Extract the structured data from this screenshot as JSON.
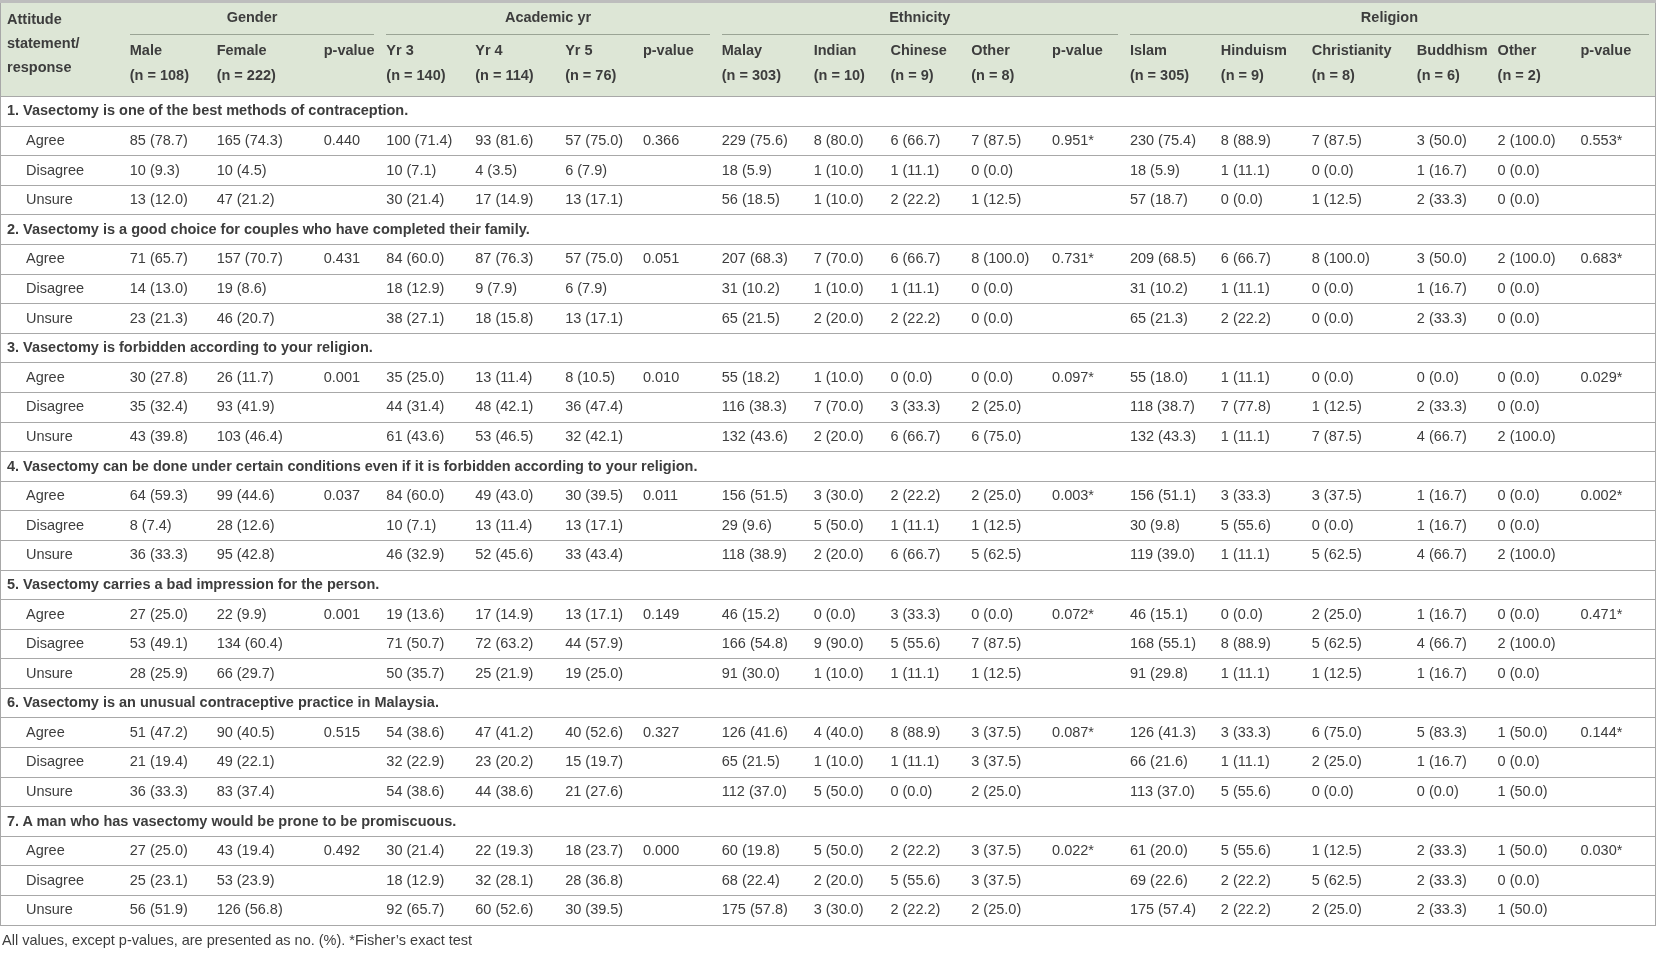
{
  "table": {
    "corner_header": "Attitude statement/ response",
    "groups": [
      {
        "title": "Gender",
        "columns": [
          {
            "label": "Male",
            "n": "(n = 108)"
          },
          {
            "label": "Female",
            "n": "(n = 222)"
          }
        ],
        "p_label": "p-value"
      },
      {
        "title": "Academic yr",
        "columns": [
          {
            "label": "Yr 3",
            "n": "(n = 140)"
          },
          {
            "label": "Yr 4",
            "n": "(n = 114)"
          },
          {
            "label": "Yr 5",
            "n": "(n = 76)"
          }
        ],
        "p_label": "p-value"
      },
      {
        "title": "Ethnicity",
        "columns": [
          {
            "label": "Malay",
            "n": "(n = 303)"
          },
          {
            "label": "Indian",
            "n": "(n = 10)"
          },
          {
            "label": "Chinese",
            "n": "(n = 9)"
          },
          {
            "label": "Other",
            "n": "(n = 8)"
          }
        ],
        "p_label": "p-value"
      },
      {
        "title": "Religion",
        "columns": [
          {
            "label": "Islam",
            "n": "(n = 305)"
          },
          {
            "label": "Hinduism",
            "n": "(n = 9)"
          },
          {
            "label": "Christianity",
            "n": "(n = 8)"
          },
          {
            "label": "Buddhism",
            "n": "(n = 6)"
          },
          {
            "label": "Other",
            "n": "(n = 2)"
          }
        ],
        "p_label": "p-value"
      }
    ],
    "sections": [
      {
        "statement": "1. Vasectomy is one of the best methods of contraception.",
        "rows": [
          {
            "response": "Agree",
            "values": [
              "85 (78.7)",
              "165 (74.3)",
              "100 (71.4)",
              "93 (81.6)",
              "57 (75.0)",
              "229 (75.6)",
              "8 (80.0)",
              "6 (66.7)",
              "7 (87.5)",
              "230 (75.4)",
              "8 (88.9)",
              "7 (87.5)",
              "3 (50.0)",
              "2 (100.0)"
            ],
            "p_values": [
              "0.440",
              "0.366",
              "0.951*",
              "0.553*"
            ]
          },
          {
            "response": "Disagree",
            "values": [
              "10 (9.3)",
              "10 (4.5)",
              "10 (7.1)",
              "4 (3.5)",
              "6 (7.9)",
              "18 (5.9)",
              "1 (10.0)",
              "1 (11.1)",
              "0 (0.0)",
              "18 (5.9)",
              "1 (11.1)",
              "0 (0.0)",
              "1 (16.7)",
              "0 (0.0)"
            ]
          },
          {
            "response": "Unsure",
            "values": [
              "13 (12.0)",
              "47 (21.2)",
              "30 (21.4)",
              "17 (14.9)",
              "13 (17.1)",
              "56 (18.5)",
              "1 (10.0)",
              "2 (22.2)",
              "1 (12.5)",
              "57 (18.7)",
              "0 (0.0)",
              "1 (12.5)",
              "2 (33.3)",
              "0 (0.0)"
            ]
          }
        ]
      },
      {
        "statement": "2. Vasectomy is a good choice for couples who have completed their family.",
        "rows": [
          {
            "response": "Agree",
            "values": [
              "71 (65.7)",
              "157 (70.7)",
              "84 (60.0)",
              "87 (76.3)",
              "57 (75.0)",
              "207 (68.3)",
              "7 (70.0)",
              "6 (66.7)",
              "8 (100.0)",
              "209 (68.5)",
              "6 (66.7)",
              "8 (100.0)",
              "3 (50.0)",
              "2 (100.0)"
            ],
            "p_values": [
              "0.431",
              "0.051",
              "0.731*",
              "0.683*"
            ]
          },
          {
            "response": "Disagree",
            "values": [
              "14 (13.0)",
              "19 (8.6)",
              "18 (12.9)",
              "9 (7.9)",
              "6 (7.9)",
              "31 (10.2)",
              "1 (10.0)",
              "1 (11.1)",
              "0 (0.0)",
              "31 (10.2)",
              "1 (11.1)",
              "0 (0.0)",
              "1 (16.7)",
              "0 (0.0)"
            ]
          },
          {
            "response": "Unsure",
            "values": [
              "23 (21.3)",
              "46 (20.7)",
              "38 (27.1)",
              "18 (15.8)",
              "13 (17.1)",
              "65 (21.5)",
              "2 (20.0)",
              "2 (22.2)",
              "0 (0.0)",
              "65 (21.3)",
              "2 (22.2)",
              "0 (0.0)",
              "2 (33.3)",
              "0 (0.0)"
            ]
          }
        ]
      },
      {
        "statement": "3. Vasectomy is forbidden according to your religion.",
        "rows": [
          {
            "response": "Agree",
            "values": [
              "30 (27.8)",
              "26 (11.7)",
              "35 (25.0)",
              "13 (11.4)",
              "8 (10.5)",
              "55 (18.2)",
              "1 (10.0)",
              "0 (0.0)",
              "0 (0.0)",
              "55 (18.0)",
              "1 (11.1)",
              "0 (0.0)",
              "0 (0.0)",
              "0 (0.0)"
            ],
            "p_values": [
              "0.001",
              "0.010",
              "0.097*",
              "0.029*"
            ]
          },
          {
            "response": "Disagree",
            "values": [
              "35 (32.4)",
              "93 (41.9)",
              "44 (31.4)",
              "48 (42.1)",
              "36 (47.4)",
              "116 (38.3)",
              "7 (70.0)",
              "3 (33.3)",
              "2 (25.0)",
              "118 (38.7)",
              "7 (77.8)",
              "1 (12.5)",
              "2 (33.3)",
              "0 (0.0)"
            ]
          },
          {
            "response": "Unsure",
            "values": [
              "43 (39.8)",
              "103 (46.4)",
              "61 (43.6)",
              "53 (46.5)",
              "32 (42.1)",
              "132 (43.6)",
              "2 (20.0)",
              "6 (66.7)",
              "6 (75.0)",
              "132 (43.3)",
              "1 (11.1)",
              "7 (87.5)",
              "4 (66.7)",
              "2 (100.0)"
            ]
          }
        ]
      },
      {
        "statement": "4. Vasectomy can be done under certain conditions even if it is forbidden according to your religion.",
        "rows": [
          {
            "response": "Agree",
            "values": [
              "64 (59.3)",
              "99 (44.6)",
              "84 (60.0)",
              "49 (43.0)",
              "30 (39.5)",
              "156 (51.5)",
              "3 (30.0)",
              "2 (22.2)",
              "2 (25.0)",
              "156 (51.1)",
              "3 (33.3)",
              "3 (37.5)",
              "1 (16.7)",
              "0 (0.0)"
            ],
            "p_values": [
              "0.037",
              "0.011",
              "0.003*",
              "0.002*"
            ]
          },
          {
            "response": "Disagree",
            "values": [
              "8 (7.4)",
              "28 (12.6)",
              "10 (7.1)",
              "13 (11.4)",
              "13 (17.1)",
              "29 (9.6)",
              "5 (50.0)",
              "1 (11.1)",
              "1 (12.5)",
              "30 (9.8)",
              "5 (55.6)",
              "0 (0.0)",
              "1 (16.7)",
              "0 (0.0)"
            ]
          },
          {
            "response": "Unsure",
            "values": [
              "36 (33.3)",
              "95 (42.8)",
              "46 (32.9)",
              "52 (45.6)",
              "33 (43.4)",
              "118 (38.9)",
              "2 (20.0)",
              "6 (66.7)",
              "5 (62.5)",
              "119 (39.0)",
              "1 (11.1)",
              "5 (62.5)",
              "4 (66.7)",
              "2 (100.0)"
            ]
          }
        ]
      },
      {
        "statement": "5. Vasectomy carries a bad impression for the person.",
        "rows": [
          {
            "response": "Agree",
            "values": [
              "27 (25.0)",
              "22 (9.9)",
              "19 (13.6)",
              "17 (14.9)",
              "13 (17.1)",
              "46 (15.2)",
              "0 (0.0)",
              "3 (33.3)",
              "0 (0.0)",
              "46 (15.1)",
              "0 (0.0)",
              "2 (25.0)",
              "1 (16.7)",
              "0 (0.0)"
            ],
            "p_values": [
              "0.001",
              "0.149",
              "0.072*",
              "0.471*"
            ]
          },
          {
            "response": "Disagree",
            "values": [
              "53 (49.1)",
              "134 (60.4)",
              "71 (50.7)",
              "72 (63.2)",
              "44 (57.9)",
              "166 (54.8)",
              "9 (90.0)",
              "5 (55.6)",
              "7 (87.5)",
              "168 (55.1)",
              "8 (88.9)",
              "5 (62.5)",
              "4 (66.7)",
              "2 (100.0)"
            ]
          },
          {
            "response": "Unsure",
            "values": [
              "28 (25.9)",
              "66 (29.7)",
              "50 (35.7)",
              "25 (21.9)",
              "19 (25.0)",
              "91 (30.0)",
              "1 (10.0)",
              "1 (11.1)",
              "1 (12.5)",
              "91 (29.8)",
              "1 (11.1)",
              "1 (12.5)",
              "1 (16.7)",
              "0 (0.0)"
            ]
          }
        ]
      },
      {
        "statement": "6. Vasectomy is an unusual contraceptive practice in Malaysia.",
        "rows": [
          {
            "response": "Agree",
            "values": [
              "51 (47.2)",
              "90 (40.5)",
              "54 (38.6)",
              "47 (41.2)",
              "40 (52.6)",
              "126 (41.6)",
              "4 (40.0)",
              "8 (88.9)",
              "3 (37.5)",
              "126 (41.3)",
              "3 (33.3)",
              "6 (75.0)",
              "5 (83.3)",
              "1 (50.0)"
            ],
            "p_values": [
              "0.515",
              "0.327",
              "0.087*",
              "0.144*"
            ]
          },
          {
            "response": "Disagree",
            "values": [
              "21 (19.4)",
              "49 (22.1)",
              "32 (22.9)",
              "23 (20.2)",
              "15 (19.7)",
              "65 (21.5)",
              "1 (10.0)",
              "1 (11.1)",
              "3 (37.5)",
              "66 (21.6)",
              "1 (11.1)",
              "2 (25.0)",
              "1 (16.7)",
              "0 (0.0)"
            ]
          },
          {
            "response": "Unsure",
            "values": [
              "36 (33.3)",
              "83 (37.4)",
              "54 (38.6)",
              "44 (38.6)",
              "21 (27.6)",
              "112 (37.0)",
              "5 (50.0)",
              "0 (0.0)",
              "2 (25.0)",
              "113 (37.0)",
              "5 (55.6)",
              "0 (0.0)",
              "0 (0.0)",
              "1 (50.0)"
            ]
          }
        ]
      },
      {
        "statement": "7. A man who has vasectomy would be prone to be promiscuous.",
        "rows": [
          {
            "response": "Agree",
            "values": [
              "27 (25.0)",
              "43 (19.4)",
              "30 (21.4)",
              "22 (19.3)",
              "18 (23.7)",
              "60 (19.8)",
              "5 (50.0)",
              "2 (22.2)",
              "3 (37.5)",
              "61 (20.0)",
              "5 (55.6)",
              "1 (12.5)",
              "2 (33.3)",
              "1 (50.0)"
            ],
            "p_values": [
              "0.492",
              "0.000",
              "0.022*",
              "0.030*"
            ]
          },
          {
            "response": "Disagree",
            "values": [
              "25 (23.1)",
              "53 (23.9)",
              "18 (12.9)",
              "32 (28.1)",
              "28 (36.8)",
              "68 (22.4)",
              "2 (20.0)",
              "5 (55.6)",
              "3 (37.5)",
              "69 (22.6)",
              "2 (22.2)",
              "5 (62.5)",
              "2 (33.3)",
              "0 (0.0)"
            ]
          },
          {
            "response": "Unsure",
            "values": [
              "56 (51.9)",
              "126 (56.8)",
              "92 (65.7)",
              "60 (52.6)",
              "30 (39.5)",
              "175 (57.8)",
              "3 (30.0)",
              "2 (22.2)",
              "2 (25.0)",
              "175 (57.4)",
              "2 (22.2)",
              "2 (25.0)",
              "2 (33.3)",
              "1 (50.0)"
            ]
          }
        ]
      }
    ]
  },
  "footnote": "All values, except p-values, are presented as no. (%). *Fisher’s exact test"
}
